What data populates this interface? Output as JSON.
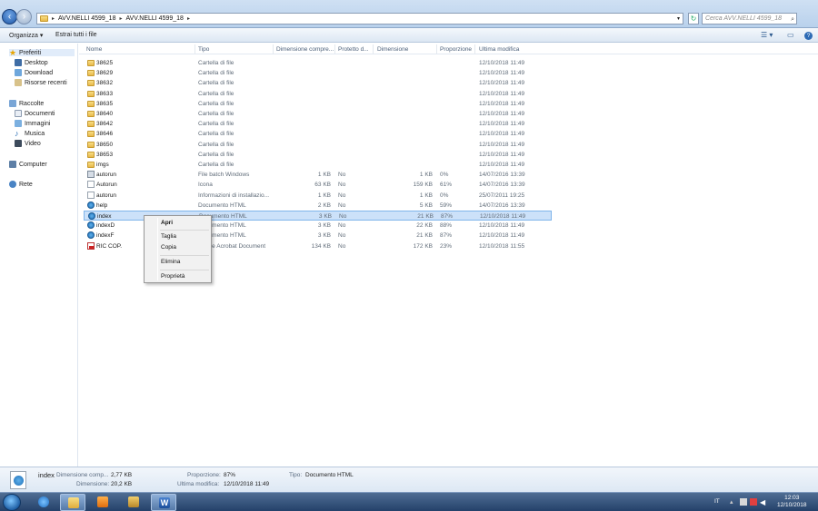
{
  "address": {
    "crumbs": [
      "AVV.NELLI 4599_18",
      "AVV.NELLI 4599_18"
    ],
    "search_placeholder": "Cerca AVV.NELLI 4599_18"
  },
  "toolbar": {
    "organize": "Organizza ▾",
    "extract": "Estrai tutti i file"
  },
  "sidebar": {
    "favorites": "Preferiti",
    "desktop": "Desktop",
    "download": "Download",
    "recent": "Risorse recenti",
    "libraries": "Raccolte",
    "documents": "Documenti",
    "images": "Immagini",
    "music": "Musica",
    "video": "Video",
    "computer": "Computer",
    "network": "Rete"
  },
  "columns": {
    "name": "Nome",
    "type": "Tipo",
    "compressed": "Dimensione compre...",
    "protected": "Protetto d...",
    "size": "Dimensione",
    "ratio": "Proporzione",
    "modified": "Ultima modifica"
  },
  "files": [
    {
      "name": "38625",
      "icon": "folder",
      "type": "Cartella di file",
      "compressed": "",
      "protected": "",
      "size": "",
      "ratio": "",
      "modified": "12/10/2018 11:49"
    },
    {
      "name": "38629",
      "icon": "folder",
      "type": "Cartella di file",
      "compressed": "",
      "protected": "",
      "size": "",
      "ratio": "",
      "modified": "12/10/2018 11:49"
    },
    {
      "name": "38632",
      "icon": "folder",
      "type": "Cartella di file",
      "compressed": "",
      "protected": "",
      "size": "",
      "ratio": "",
      "modified": "12/10/2018 11:49"
    },
    {
      "name": "38633",
      "icon": "folder",
      "type": "Cartella di file",
      "compressed": "",
      "protected": "",
      "size": "",
      "ratio": "",
      "modified": "12/10/2018 11:49"
    },
    {
      "name": "38635",
      "icon": "folder",
      "type": "Cartella di file",
      "compressed": "",
      "protected": "",
      "size": "",
      "ratio": "",
      "modified": "12/10/2018 11:49"
    },
    {
      "name": "38640",
      "icon": "folder",
      "type": "Cartella di file",
      "compressed": "",
      "protected": "",
      "size": "",
      "ratio": "",
      "modified": "12/10/2018 11:49"
    },
    {
      "name": "38642",
      "icon": "folder",
      "type": "Cartella di file",
      "compressed": "",
      "protected": "",
      "size": "",
      "ratio": "",
      "modified": "12/10/2018 11:49"
    },
    {
      "name": "38646",
      "icon": "folder",
      "type": "Cartella di file",
      "compressed": "",
      "protected": "",
      "size": "",
      "ratio": "",
      "modified": "12/10/2018 11:49"
    },
    {
      "name": "38650",
      "icon": "folder",
      "type": "Cartella di file",
      "compressed": "",
      "protected": "",
      "size": "",
      "ratio": "",
      "modified": "12/10/2018 11:49"
    },
    {
      "name": "38653",
      "icon": "folder",
      "type": "Cartella di file",
      "compressed": "",
      "protected": "",
      "size": "",
      "ratio": "",
      "modified": "12/10/2018 11:49"
    },
    {
      "name": "imgs",
      "icon": "folder",
      "type": "Cartella di file",
      "compressed": "",
      "protected": "",
      "size": "",
      "ratio": "",
      "modified": "12/10/2018 11:49"
    },
    {
      "name": "autorun",
      "icon": "bat",
      "type": "File batch Windows",
      "compressed": "1 KB",
      "protected": "No",
      "size": "1 KB",
      "ratio": "0%",
      "modified": "14/07/2016 13:39"
    },
    {
      "name": "Autorun",
      "icon": "icon",
      "type": "Icona",
      "compressed": "63 KB",
      "protected": "No",
      "size": "159 KB",
      "ratio": "61%",
      "modified": "14/07/2016 13:39"
    },
    {
      "name": "autorun",
      "icon": "inf",
      "type": "Informazioni di installazio...",
      "compressed": "1 KB",
      "protected": "No",
      "size": "1 KB",
      "ratio": "0%",
      "modified": "25/07/2011 19:25"
    },
    {
      "name": "help",
      "icon": "html",
      "type": "Documento HTML",
      "compressed": "2 KB",
      "protected": "No",
      "size": "5 KB",
      "ratio": "59%",
      "modified": "14/07/2016 13:39"
    },
    {
      "name": "index",
      "icon": "html",
      "type": "Documento HTML",
      "compressed": "3 KB",
      "protected": "No",
      "size": "21 KB",
      "ratio": "87%",
      "modified": "12/10/2018 11:49",
      "selected": true
    },
    {
      "name": "indexD",
      "icon": "html",
      "type": "Documento HTML",
      "compressed": "3 KB",
      "protected": "No",
      "size": "22 KB",
      "ratio": "88%",
      "modified": "12/10/2018 11:49"
    },
    {
      "name": "indexF",
      "icon": "html",
      "type": "Documento HTML",
      "compressed": "3 KB",
      "protected": "No",
      "size": "21 KB",
      "ratio": "87%",
      "modified": "12/10/2018 11:49"
    },
    {
      "name": "RIC COP.",
      "icon": "pdf",
      "type": "Adobe Acrobat Document",
      "compressed": "134 KB",
      "protected": "No",
      "size": "172 KB",
      "ratio": "23%",
      "modified": "12/10/2018 11:55"
    }
  ],
  "context_menu": {
    "open": "Apri",
    "cut": "Taglia",
    "copy": "Copia",
    "delete": "Elimina",
    "properties": "Proprietà"
  },
  "details": {
    "name": "index",
    "compressed_label": "Dimensione comp...",
    "compressed_value": "2,77 KB",
    "size_label": "Dimensione:",
    "size_value": "20,2 KB",
    "ratio_label": "Proporzione:",
    "ratio_value": "87%",
    "modified_label": "Ultima modifica:",
    "modified_value": "12/10/2018 11:49",
    "type_label": "Tipo:",
    "type_value": "Documento HTML"
  },
  "taskbar": {
    "lang": "IT",
    "time": "12:03",
    "date": "12/10/2018"
  }
}
